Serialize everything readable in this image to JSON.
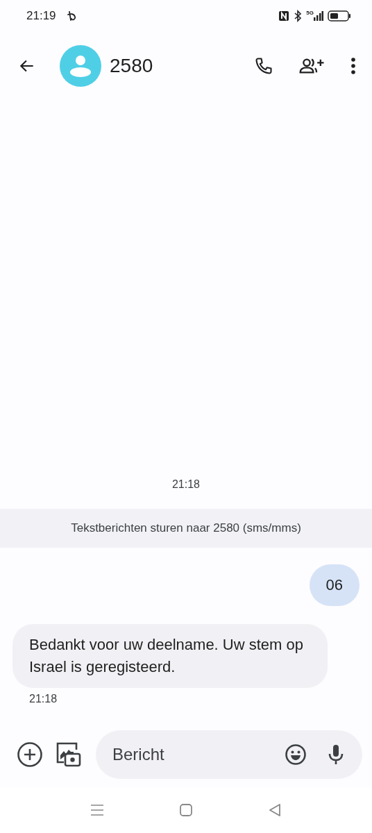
{
  "status_bar": {
    "time": "21:19",
    "network": "5G"
  },
  "header": {
    "title": "2580"
  },
  "conversation": {
    "timestamp": "21:18",
    "banner": "Tekstberichten sturen naar 2580 (sms/mms)",
    "messages": [
      {
        "kind": "sent",
        "text": "06"
      },
      {
        "kind": "received",
        "text": "Bedankt voor uw deelname. Uw stem op Israel is geregisteerd.",
        "time": "21:18"
      }
    ]
  },
  "composer": {
    "placeholder": "Bericht"
  }
}
